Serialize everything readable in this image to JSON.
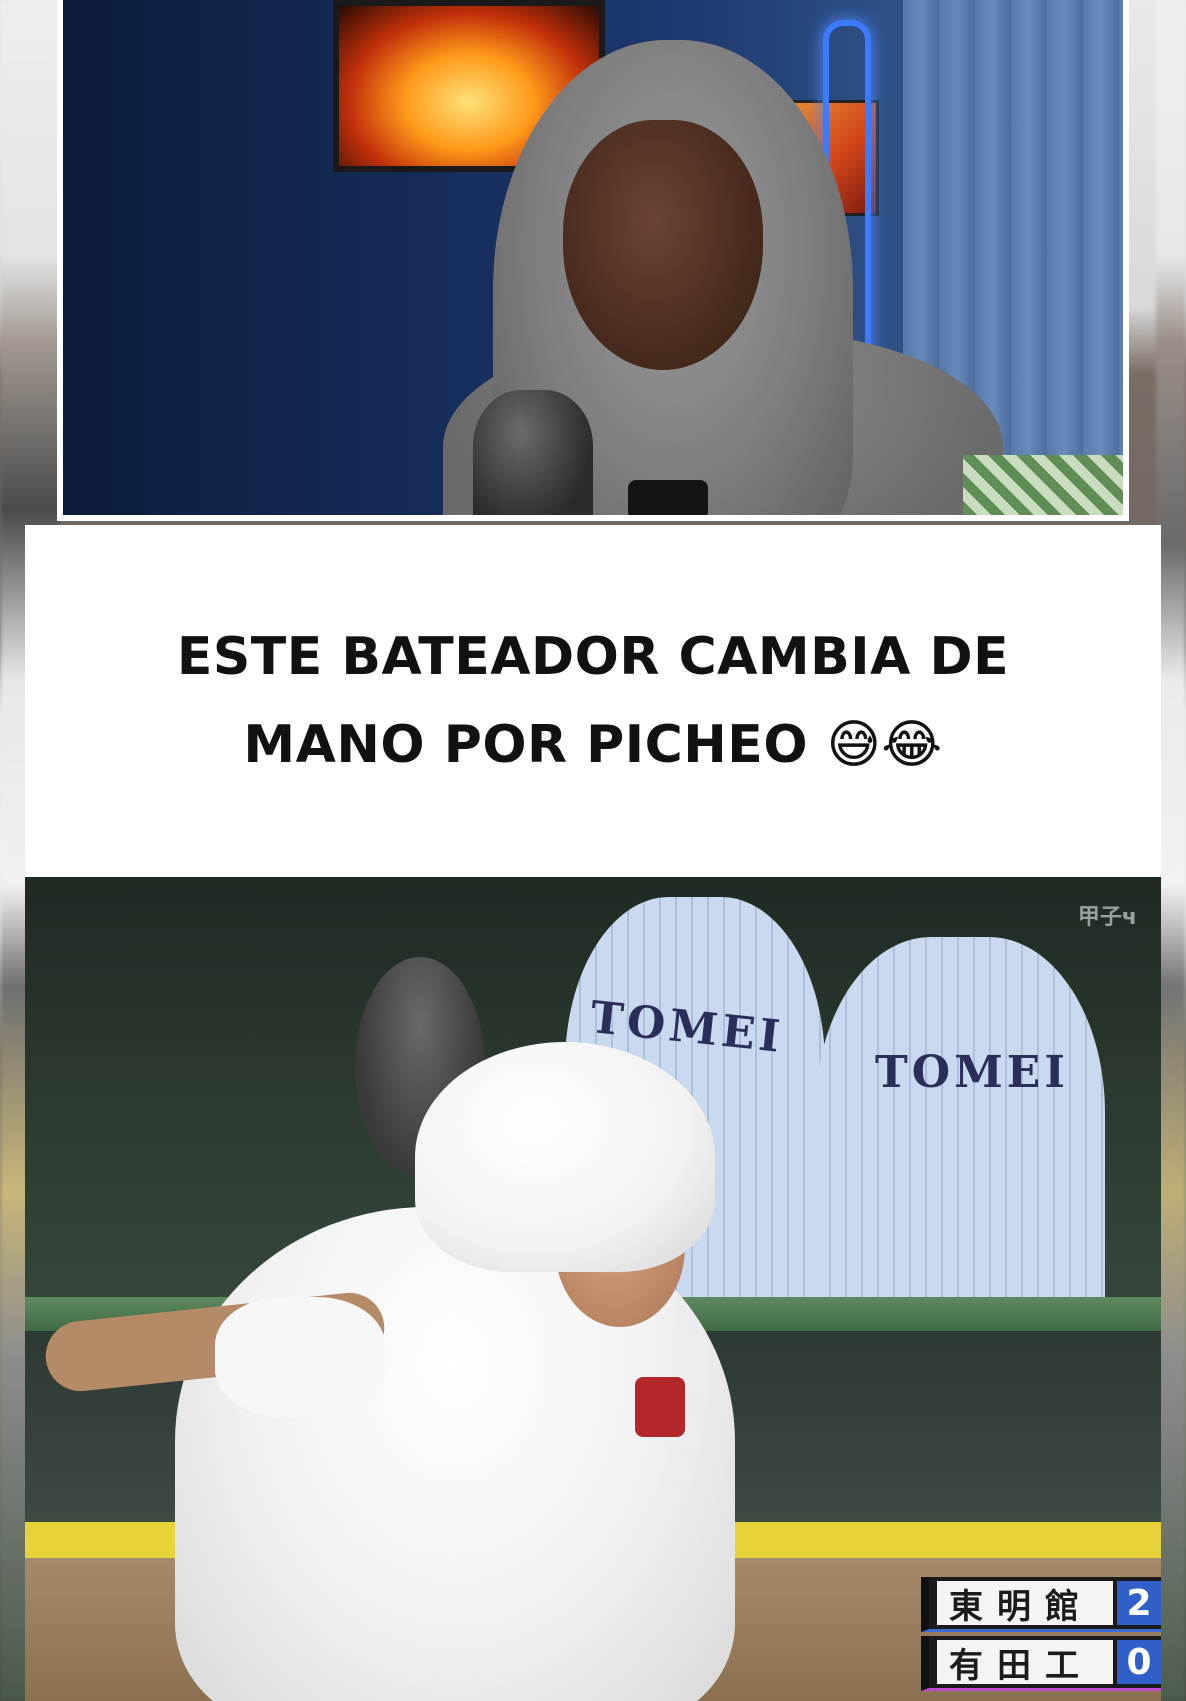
{
  "caption": {
    "line1": "ESTE BATEADOR CAMBIA DE",
    "line2": "MANO POR PICHEO 😅😂"
  },
  "webcam": {
    "alt": "reaction-webcam"
  },
  "video": {
    "team_text_1": "TOMEI",
    "team_text_2": "TOMEI",
    "channel_mark": "甲子ч"
  },
  "scoreboard": {
    "home_team": "東明館",
    "home_score": "2",
    "away_team": "有田工",
    "away_score": "0"
  },
  "colors": {
    "score_home_accent": "#3a6bd6",
    "score_away_accent": "#c04bd1",
    "score_box": "#2f5fc7"
  }
}
